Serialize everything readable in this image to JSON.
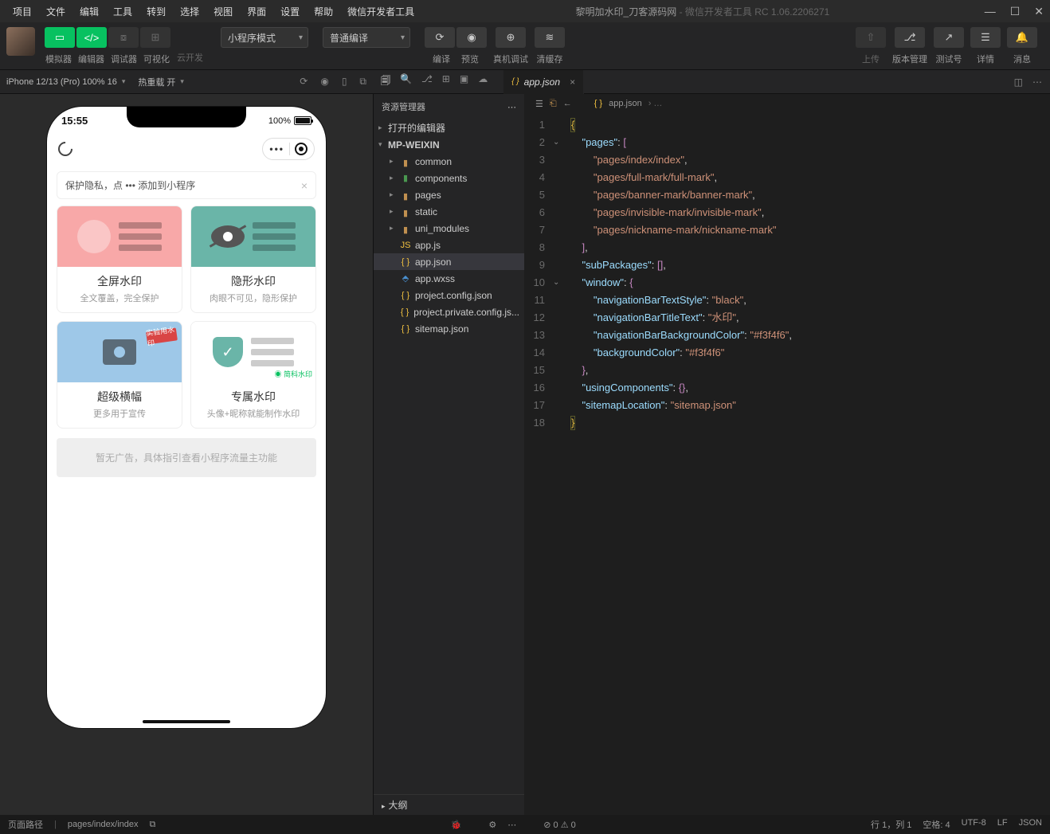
{
  "menubar": [
    "项目",
    "文件",
    "编辑",
    "工具",
    "转到",
    "选择",
    "视图",
    "界面",
    "设置",
    "帮助",
    "微信开发者工具"
  ],
  "apptitle": {
    "main": "黎明加水印_刀客源码网",
    "sub": " - 微信开发者工具 RC 1.06.2206271"
  },
  "toolbar": {
    "sim": "模拟器",
    "editor": "编辑器",
    "debugger": "调试器",
    "visual": "可视化",
    "cloud": "云开发",
    "modeSel": "小程序模式",
    "compileSel": "普通编译",
    "compile": "编译",
    "preview": "预览",
    "realdbg": "真机调试",
    "clearcache": "清缓存",
    "upload": "上传",
    "version": "版本管理",
    "testid": "测试号",
    "detail": "详情",
    "message": "消息"
  },
  "subbar": {
    "device": "iPhone 12/13 (Pro) 100% 16",
    "reload": "热重载 开"
  },
  "phone": {
    "time": "15:55",
    "battery": "100%",
    "tip": "保护隐私，点 ••• 添加到小程序",
    "cards": [
      {
        "title": "全屏水印",
        "sub": "全文覆盖，完全保护"
      },
      {
        "title": "隐形水印",
        "sub": "肉眼不可见，隐形保护"
      },
      {
        "title": "超级横幅",
        "sub": "更多用于宣传",
        "badge": "实验用水印"
      },
      {
        "title": "专属水印",
        "sub": "头像+昵称就能制作水印",
        "mark": "◉ 简科水印"
      }
    ],
    "ad": "暂无广告，具体指引查看小程序流量主功能"
  },
  "explorer": {
    "title": "资源管理器",
    "openEditors": "打开的编辑器",
    "root": "MP-WEIXIN",
    "folders": [
      "common",
      "components",
      "pages",
      "static",
      "uni_modules"
    ],
    "files": [
      "app.js",
      "app.json",
      "app.wxss",
      "project.config.json",
      "project.private.config.js...",
      "sitemap.json"
    ],
    "outline": "大纲"
  },
  "editor": {
    "tab": "app.json",
    "crumb": "app.json",
    "lines": [
      "1",
      "2",
      "3",
      "4",
      "5",
      "6",
      "7",
      "8",
      "9",
      "10",
      "11",
      "12",
      "13",
      "14",
      "15",
      "16",
      "17",
      "18"
    ]
  },
  "statusbar": {
    "pathlabel": "页面路径",
    "path": "pages/index/index",
    "errs": "⊘ 0 ⚠ 0",
    "pos": "行 1，列 1",
    "spaces": "空格: 4",
    "enc": "UTF-8",
    "eol": "LF",
    "lang": "JSON"
  }
}
